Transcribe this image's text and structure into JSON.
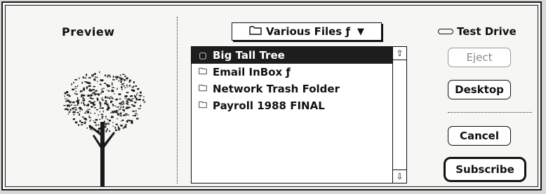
{
  "preview": {
    "label": "Preview"
  },
  "folder_popup": {
    "label": "Various Files ƒ",
    "icon": "folder-icon"
  },
  "drive": {
    "name": "Test Drive",
    "icon": "disk-icon"
  },
  "files": [
    {
      "name": "Big Tall Tree",
      "icon": "file-icon",
      "selected": true
    },
    {
      "name": "Email InBox ƒ",
      "icon": "folder-icon",
      "selected": false
    },
    {
      "name": "Network Trash Folder",
      "icon": "folder-icon",
      "selected": false
    },
    {
      "name": "Payroll 1988 FINAL",
      "icon": "folder-icon",
      "selected": false
    }
  ],
  "buttons": {
    "eject": "Eject",
    "desktop": "Desktop",
    "cancel": "Cancel",
    "subscribe": "Subscribe"
  },
  "scroll": {
    "up": "⇧",
    "down": "⇩"
  }
}
